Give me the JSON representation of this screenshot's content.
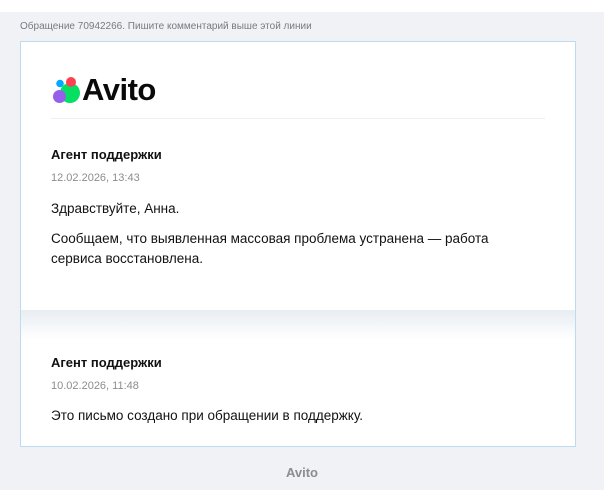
{
  "ticket_header": "Обращение 70942266. Пишите комментарий выше этой линии",
  "logo": {
    "text": "Avito",
    "colors": [
      "#04e061",
      "#965eeb",
      "#ff4053",
      "#0af"
    ]
  },
  "messages": [
    {
      "author": "Агент поддержки",
      "date": "12.02.2026, 13:43",
      "greeting": "Здравствуйте, Анна.",
      "body": "Сообщаем, что выявленная массовая проблема устранена — работа сервиса восстановлена."
    },
    {
      "author": "Агент поддержки",
      "date": "10.02.2026, 11:48",
      "body": "Это письмо создано при обращении в поддержку."
    }
  ],
  "footer": "Avito"
}
